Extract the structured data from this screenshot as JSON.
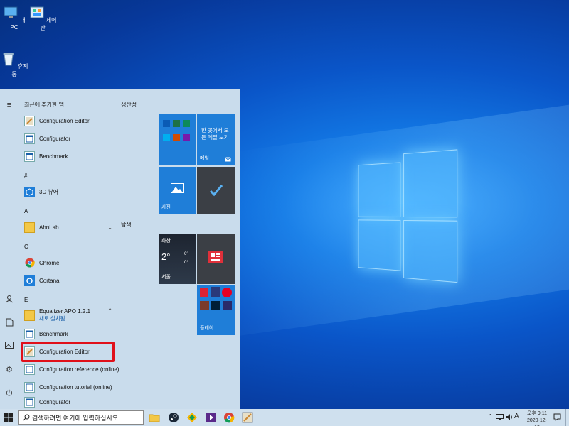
{
  "desktop": {
    "icons": [
      {
        "label": "내 PC"
      },
      {
        "label": "제어판"
      },
      {
        "label": "휴지통"
      }
    ]
  },
  "start_menu": {
    "recent_header": "최근에 추가한 앱",
    "productivity_header": "생산성",
    "explore_header": "탐색",
    "recent_apps": [
      "Configuration Editor",
      "Configurator",
      "Benchmark"
    ],
    "section_hash": "#",
    "app_3d": "3D 뷰어",
    "section_a": "A",
    "app_ahnlab": "AhnLab",
    "section_c": "C",
    "app_chrome": "Chrome",
    "app_cortana": "Cortana",
    "section_e": "E",
    "equalizer": {
      "name": "Equalizer APO 1.2.1",
      "sub": "새로 설치됨"
    },
    "equalizer_children": [
      "Benchmark",
      "Configuration Editor",
      "Configuration reference (online)",
      "Configuration tutorial (online)",
      "Configurator"
    ],
    "tiles": {
      "mail_text": "한 곳에서 모든 메일 보기",
      "mail_label": "메일",
      "photos_label": "사진",
      "weather_city": "서울",
      "weather_condition": "화창",
      "weather_temp": "2°",
      "weather_high": "6°",
      "weather_low": "0°",
      "play_label": "플레이"
    }
  },
  "taskbar": {
    "search_placeholder": "검색하려면 여기에 입력하십시오.",
    "ime": "A",
    "time": "오후 9:11",
    "date": "2020-12-12"
  },
  "colors": {
    "highlight": "#e0101a",
    "accent": "#0078d7"
  }
}
